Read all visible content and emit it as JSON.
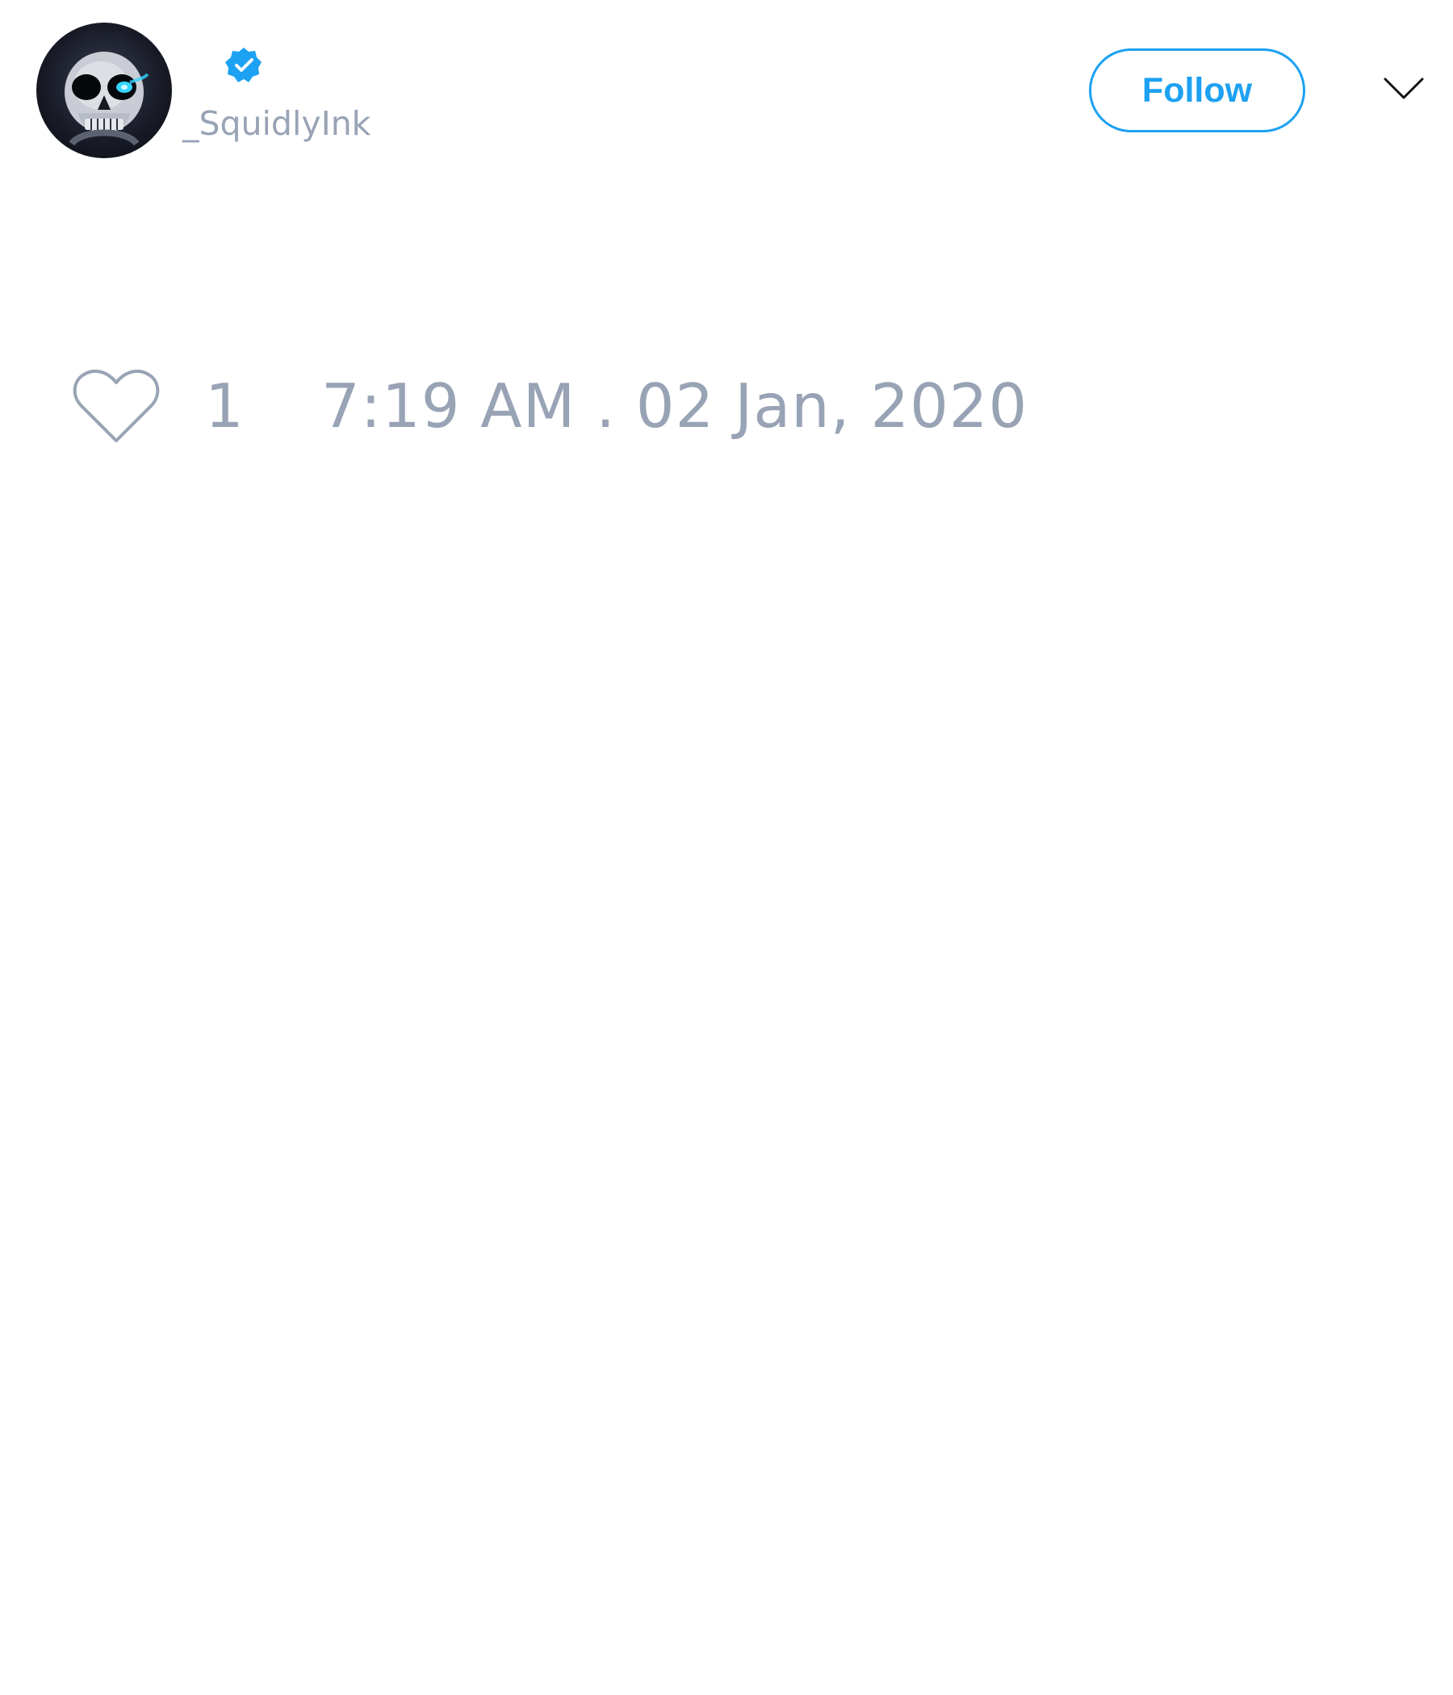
{
  "tweet": {
    "author": {
      "handle": "_SquidlyInk",
      "avatar": "skull-avatar",
      "verified_icon": "verified-badge-icon"
    },
    "follow_label": "Follow",
    "menu_icon": "chevron-down-icon",
    "like_icon": "heart-outline-icon",
    "likes": "1",
    "timestamp": "7:19 AM . 02 Jan, 2020"
  },
  "colors": {
    "accent": "#1da1f2",
    "muted_text": "#98a3b5",
    "background": "#ffffff"
  }
}
